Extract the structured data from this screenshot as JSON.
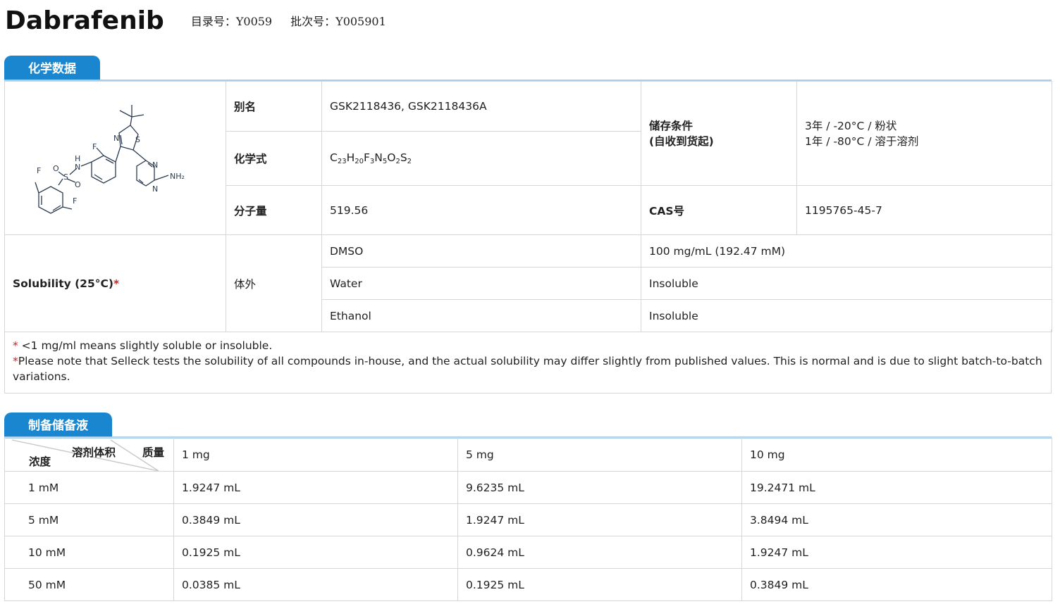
{
  "header": {
    "product_name": "Dabrafenib",
    "catalog_label": "目录号：",
    "catalog_no": "Y0059",
    "batch_label": "批次号：",
    "batch_no": "Y005901"
  },
  "chem_section": {
    "tab_label": "化学数据",
    "alias_label": "别名",
    "alias_value": "GSK2118436, GSK2118436A",
    "formula_label": "化学式",
    "formula_parts": [
      {
        "t": "C"
      },
      {
        "s": "23"
      },
      {
        "t": "H"
      },
      {
        "s": "20"
      },
      {
        "t": "F"
      },
      {
        "s": "3"
      },
      {
        "t": "N"
      },
      {
        "s": "5"
      },
      {
        "t": "O"
      },
      {
        "s": "2"
      },
      {
        "t": "S"
      },
      {
        "s": "2"
      }
    ],
    "mw_label": "分子量",
    "mw_value": "519.56",
    "storage_label_1": "储存条件",
    "storage_label_2": "(自收到货起)",
    "storage_value_1": "3年 / -20°C / 粉状",
    "storage_value_2": "1年 / -80°C / 溶于溶剂",
    "cas_label": "CAS号",
    "cas_value": "1195765-45-7",
    "structure_atoms": [
      "N",
      "S",
      "F",
      "H",
      "N",
      "O",
      "S",
      "O",
      "N",
      "N",
      "NH₂",
      "F",
      "F"
    ]
  },
  "solubility": {
    "label": "Solubility (25°C)",
    "asterisk": "*",
    "context": "体外",
    "rows": [
      {
        "solvent": "DMSO",
        "value": "100 mg/mL (192.47 mM)"
      },
      {
        "solvent": "Water",
        "value": "Insoluble"
      },
      {
        "solvent": "Ethanol",
        "value": "Insoluble"
      }
    ]
  },
  "notes": [
    {
      "star": "*",
      "text": " <1 mg/ml means slightly soluble or insoluble."
    },
    {
      "star": "*",
      "text": "Please note that Selleck tests the solubility of all compounds in-house, and the actual solubility may differ slightly from published values. This is normal and is due to slight batch-to-batch variations."
    }
  ],
  "stock_section": {
    "tab_label": "制备储备液",
    "header_conc": "浓度",
    "header_volume": "溶剂体积",
    "header_mass": "质量",
    "masses": [
      "1 mg",
      "5 mg",
      "10 mg"
    ],
    "rows": [
      {
        "conc": "1 mM",
        "vals": [
          "1.9247 mL",
          "9.6235 mL",
          "19.2471 mL"
        ]
      },
      {
        "conc": "5 mM",
        "vals": [
          "0.3849 mL",
          "1.9247 mL",
          "3.8494 mL"
        ]
      },
      {
        "conc": "10 mM",
        "vals": [
          "0.1925 mL",
          "0.9624 mL",
          "1.9247 mL"
        ]
      },
      {
        "conc": "50 mM",
        "vals": [
          "0.0385 mL",
          "0.1925 mL",
          "0.3849 mL"
        ]
      }
    ]
  },
  "colors": {
    "accent": "#1a86d0",
    "accent_line": "#aacde9",
    "border": "#d6d6d6",
    "asterisk": "#e01b1b"
  }
}
